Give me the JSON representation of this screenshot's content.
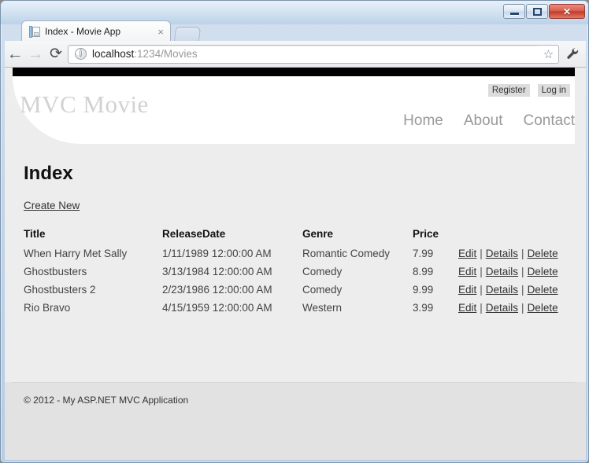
{
  "window": {
    "controls": {
      "minimize_label": "Minimize",
      "maximize_label": "Maximize",
      "close_label": "✕"
    }
  },
  "browser": {
    "tab": {
      "title": "Index - Movie App",
      "close_label": "×",
      "favicon": "document-icon"
    },
    "new_tab_label": "",
    "toolbar": {
      "back_icon": "←",
      "forward_icon": "→",
      "reload_icon": "⟳",
      "star_icon": "☆",
      "wrench_icon": "wrench-icon"
    },
    "address": {
      "host": "localhost",
      "rest": ":1234/Movies",
      "full": "localhost:1234/Movies",
      "security_icon": "globe-icon"
    }
  },
  "site": {
    "brand": "MVC Movie",
    "auth": [
      {
        "label": "Register",
        "name": "register-link"
      },
      {
        "label": "Log in",
        "name": "login-link"
      }
    ],
    "nav": [
      {
        "label": "Home",
        "name": "nav-home"
      },
      {
        "label": "About",
        "name": "nav-about"
      },
      {
        "label": "Contact",
        "name": "nav-contact"
      }
    ],
    "footer": "© 2012 - My ASP.NET MVC Application"
  },
  "main": {
    "heading": "Index",
    "create_link": "Create New",
    "table": {
      "headers": [
        "Title",
        "ReleaseDate",
        "Genre",
        "Price",
        ""
      ],
      "rows": [
        {
          "title": "When Harry Met Sally",
          "release_date": "1/11/1989 12:00:00 AM",
          "genre": "Romantic Comedy",
          "price": "7.99"
        },
        {
          "title": "Ghostbusters",
          "release_date": "3/13/1984 12:00:00 AM",
          "genre": "Comedy",
          "price": "8.99"
        },
        {
          "title": "Ghostbusters 2",
          "release_date": "2/23/1986 12:00:00 AM",
          "genre": "Comedy",
          "price": "9.99"
        },
        {
          "title": "Rio Bravo",
          "release_date": "4/15/1959 12:00:00 AM",
          "genre": "Western",
          "price": "3.99"
        }
      ],
      "actions": {
        "edit": "Edit",
        "details": "Details",
        "delete": "Delete",
        "separator": "|"
      }
    }
  },
  "colors": {
    "page_bg": "#ededed",
    "footer_bg": "#e2e2e2",
    "header_bg": "#ffffff",
    "brand_text": "#d2d2d2",
    "black_bar": "#000000",
    "window_frame": "#b7cce2",
    "close_button": "#c33a28"
  }
}
